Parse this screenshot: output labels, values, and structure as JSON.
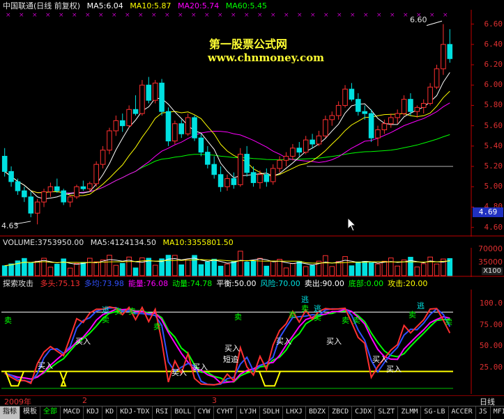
{
  "colors": {
    "background": "#000000",
    "up_candle": "#ff3030",
    "down_candle": "#00e0e0",
    "ma5": "#ffffff",
    "ma10": "#ffff00",
    "ma20": "#ff00ff",
    "ma60": "#00ff00",
    "axis": "#c00000",
    "watermark": "#ffff33"
  },
  "main_legend": {
    "title": "中国联通(日线 前复权)",
    "ma5": "MA5:6.04",
    "ma10": "MA10:5.87",
    "ma20": "MA20:5.74",
    "ma60": "MA60:5.45"
  },
  "watermark": {
    "line1": "第一股票公式网",
    "line2": "www.chnmoney.com"
  },
  "price_axis": {
    "ticks": [
      "6.60",
      "6.40",
      "6.20",
      "6.00",
      "5.80",
      "5.60",
      "5.40",
      "5.20",
      "5.00",
      "4.80",
      "4.60"
    ],
    "current_price": "4.69",
    "high_label": "6.60",
    "low_label": "4.63"
  },
  "volume_legend": {
    "volume": "VOLUME:3753950.00",
    "ma5": "MA5:4124134.50",
    "ma10": "MA10:3355801.50"
  },
  "volume_axis": {
    "ticks": [
      "70000",
      "35000"
    ],
    "unit": "X100"
  },
  "indicator_legend": {
    "name": "探索攻击",
    "items": [
      {
        "text": "多头:75.13",
        "color": "#ff3030"
      },
      {
        "text": "多均:73.98",
        "color": "#3050ff"
      },
      {
        "text": "能量:76.08",
        "color": "#ff00ff"
      },
      {
        "text": "动量:74.78",
        "color": "#00ff00"
      },
      {
        "text": "平衡:50.00",
        "color": "#ffffff"
      },
      {
        "text": "风险:70.00",
        "color": "#00e0e0"
      },
      {
        "text": "卖出:90.00",
        "color": "#ffffff"
      },
      {
        "text": "底部:0.00",
        "color": "#00ff00"
      },
      {
        "text": "攻击:20.00",
        "color": "#ffff00"
      }
    ]
  },
  "indicator_axis": {
    "ticks": [
      "100.0",
      "75.00",
      "50.00",
      "25.00"
    ]
  },
  "indicator_signals": {
    "sell": "卖",
    "buy": "买入",
    "escape": "逃",
    "short_chase": "短追"
  },
  "time_axis": {
    "labels": [
      "2009年",
      "2",
      "3"
    ],
    "period": "日线"
  },
  "bottom_tabs": [
    {
      "label": "指标",
      "style": "active"
    },
    {
      "label": "模板",
      "style": ""
    },
    {
      "label": "全部",
      "style": "green"
    },
    {
      "label": "MACD",
      "style": ""
    },
    {
      "label": "KDJ",
      "style": ""
    },
    {
      "label": "KD",
      "style": ""
    },
    {
      "label": "KDJ-TDX",
      "style": ""
    },
    {
      "label": "RSI",
      "style": ""
    },
    {
      "label": "BOLL",
      "style": ""
    },
    {
      "label": "CYW",
      "style": ""
    },
    {
      "label": "CYHT",
      "style": ""
    },
    {
      "label": "LYJH",
      "style": ""
    },
    {
      "label": "SDLH",
      "style": ""
    },
    {
      "label": "LHXJ",
      "style": ""
    },
    {
      "label": "BDZX",
      "style": ""
    },
    {
      "label": "ZBCD",
      "style": ""
    },
    {
      "label": "CJDX",
      "style": ""
    },
    {
      "label": "SLZT",
      "style": ""
    },
    {
      "label": "ZLMM",
      "style": ""
    },
    {
      "label": "SG-LB",
      "style": ""
    },
    {
      "label": "ACCER",
      "style": ""
    },
    {
      "label": "JS",
      "style": ""
    },
    {
      "label": "MFI",
      "style": ""
    }
  ],
  "chart_data": {
    "type": "candlestick",
    "price_series": [
      {
        "o": 5.3,
        "h": 5.38,
        "l": 5.1,
        "c": 5.15
      },
      {
        "o": 5.15,
        "h": 5.2,
        "l": 5.0,
        "c": 5.05
      },
      {
        "o": 5.05,
        "h": 5.08,
        "l": 4.92,
        "c": 4.96
      },
      {
        "o": 4.96,
        "h": 5.0,
        "l": 4.85,
        "c": 4.9
      },
      {
        "o": 4.9,
        "h": 4.95,
        "l": 4.7,
        "c": 4.74
      },
      {
        "o": 4.74,
        "h": 4.88,
        "l": 4.63,
        "c": 4.85
      },
      {
        "o": 4.85,
        "h": 4.98,
        "l": 4.8,
        "c": 4.95
      },
      {
        "o": 4.95,
        "h": 5.04,
        "l": 4.9,
        "c": 5.0
      },
      {
        "o": 5.0,
        "h": 5.08,
        "l": 4.94,
        "c": 4.96
      },
      {
        "o": 4.96,
        "h": 4.98,
        "l": 4.82,
        "c": 4.85
      },
      {
        "o": 4.85,
        "h": 4.92,
        "l": 4.8,
        "c": 4.9
      },
      {
        "o": 4.9,
        "h": 5.02,
        "l": 4.88,
        "c": 5.0
      },
      {
        "o": 5.0,
        "h": 5.06,
        "l": 4.96,
        "c": 4.98
      },
      {
        "o": 4.98,
        "h": 5.05,
        "l": 4.95,
        "c": 5.03
      },
      {
        "o": 5.03,
        "h": 5.25,
        "l": 5.0,
        "c": 5.22
      },
      {
        "o": 5.22,
        "h": 5.4,
        "l": 5.18,
        "c": 5.36
      },
      {
        "o": 5.36,
        "h": 5.58,
        "l": 5.32,
        "c": 5.55
      },
      {
        "o": 5.55,
        "h": 5.7,
        "l": 5.5,
        "c": 5.65
      },
      {
        "o": 5.65,
        "h": 5.72,
        "l": 5.54,
        "c": 5.6
      },
      {
        "o": 5.6,
        "h": 5.8,
        "l": 5.58,
        "c": 5.76
      },
      {
        "o": 5.76,
        "h": 5.9,
        "l": 5.7,
        "c": 5.72
      },
      {
        "o": 5.72,
        "h": 6.05,
        "l": 5.7,
        "c": 6.0
      },
      {
        "o": 6.0,
        "h": 6.08,
        "l": 5.82,
        "c": 5.85
      },
      {
        "o": 5.85,
        "h": 6.05,
        "l": 5.82,
        "c": 6.02
      },
      {
        "o": 6.02,
        "h": 6.06,
        "l": 5.7,
        "c": 5.74
      },
      {
        "o": 5.74,
        "h": 5.78,
        "l": 5.4,
        "c": 5.45
      },
      {
        "o": 5.45,
        "h": 5.65,
        "l": 5.42,
        "c": 5.62
      },
      {
        "o": 5.62,
        "h": 5.66,
        "l": 5.48,
        "c": 5.52
      },
      {
        "o": 5.52,
        "h": 5.72,
        "l": 5.5,
        "c": 5.68
      },
      {
        "o": 5.68,
        "h": 5.7,
        "l": 5.45,
        "c": 5.48
      },
      {
        "o": 5.48,
        "h": 5.52,
        "l": 5.3,
        "c": 5.34
      },
      {
        "o": 5.34,
        "h": 5.4,
        "l": 5.18,
        "c": 5.22
      },
      {
        "o": 5.22,
        "h": 5.3,
        "l": 5.08,
        "c": 5.12
      },
      {
        "o": 5.12,
        "h": 5.2,
        "l": 4.95,
        "c": 5.0
      },
      {
        "o": 5.0,
        "h": 5.12,
        "l": 4.96,
        "c": 5.08
      },
      {
        "o": 5.08,
        "h": 5.14,
        "l": 4.98,
        "c": 5.02
      },
      {
        "o": 5.02,
        "h": 5.38,
        "l": 5.0,
        "c": 5.32
      },
      {
        "o": 5.32,
        "h": 5.4,
        "l": 5.1,
        "c": 5.14
      },
      {
        "o": 5.14,
        "h": 5.2,
        "l": 5.0,
        "c": 5.04
      },
      {
        "o": 5.04,
        "h": 5.16,
        "l": 4.98,
        "c": 5.12
      },
      {
        "o": 5.12,
        "h": 5.18,
        "l": 5.0,
        "c": 5.05
      },
      {
        "o": 5.05,
        "h": 5.22,
        "l": 5.02,
        "c": 5.18
      },
      {
        "o": 5.18,
        "h": 5.3,
        "l": 5.14,
        "c": 5.26
      },
      {
        "o": 5.26,
        "h": 5.34,
        "l": 5.2,
        "c": 5.3
      },
      {
        "o": 5.3,
        "h": 5.42,
        "l": 5.26,
        "c": 5.38
      },
      {
        "o": 5.38,
        "h": 5.44,
        "l": 5.3,
        "c": 5.34
      },
      {
        "o": 5.34,
        "h": 5.5,
        "l": 5.32,
        "c": 5.46
      },
      {
        "o": 5.46,
        "h": 5.52,
        "l": 5.38,
        "c": 5.42
      },
      {
        "o": 5.42,
        "h": 5.55,
        "l": 5.4,
        "c": 5.5
      },
      {
        "o": 5.5,
        "h": 5.7,
        "l": 5.48,
        "c": 5.66
      },
      {
        "o": 5.66,
        "h": 5.74,
        "l": 5.6,
        "c": 5.7
      },
      {
        "o": 5.7,
        "h": 5.84,
        "l": 5.66,
        "c": 5.8
      },
      {
        "o": 5.8,
        "h": 6.0,
        "l": 5.78,
        "c": 5.96
      },
      {
        "o": 5.96,
        "h": 6.02,
        "l": 5.84,
        "c": 5.86
      },
      {
        "o": 5.86,
        "h": 5.92,
        "l": 5.7,
        "c": 5.74
      },
      {
        "o": 5.74,
        "h": 5.8,
        "l": 5.66,
        "c": 5.72
      },
      {
        "o": 5.72,
        "h": 5.76,
        "l": 5.44,
        "c": 5.48
      },
      {
        "o": 5.48,
        "h": 5.6,
        "l": 5.4,
        "c": 5.56
      },
      {
        "o": 5.56,
        "h": 5.66,
        "l": 5.52,
        "c": 5.62
      },
      {
        "o": 5.62,
        "h": 5.72,
        "l": 5.58,
        "c": 5.68
      },
      {
        "o": 5.68,
        "h": 5.76,
        "l": 5.62,
        "c": 5.72
      },
      {
        "o": 5.72,
        "h": 5.9,
        "l": 5.7,
        "c": 5.86
      },
      {
        "o": 5.86,
        "h": 5.92,
        "l": 5.7,
        "c": 5.74
      },
      {
        "o": 5.74,
        "h": 5.8,
        "l": 5.68,
        "c": 5.78
      },
      {
        "o": 5.78,
        "h": 5.86,
        "l": 5.72,
        "c": 5.82
      },
      {
        "o": 5.82,
        "h": 6.02,
        "l": 5.8,
        "c": 5.98
      },
      {
        "o": 5.98,
        "h": 6.2,
        "l": 5.96,
        "c": 6.16
      },
      {
        "o": 6.16,
        "h": 6.6,
        "l": 6.1,
        "c": 6.4
      },
      {
        "o": 6.4,
        "h": 6.55,
        "l": 6.22,
        "c": 6.26
      }
    ],
    "ma_values": {
      "MA5": 6.04,
      "MA10": 5.87,
      "MA20": 5.74,
      "MA60": 5.45
    },
    "price_range": [
      4.55,
      6.7
    ],
    "volume_range": [
      0,
      80000
    ],
    "indicator_range": [
      0,
      110
    ],
    "indicator_levels": {
      "sell": 90,
      "risk": 70,
      "balance": 50,
      "attack": 20,
      "bottom": 0
    }
  }
}
